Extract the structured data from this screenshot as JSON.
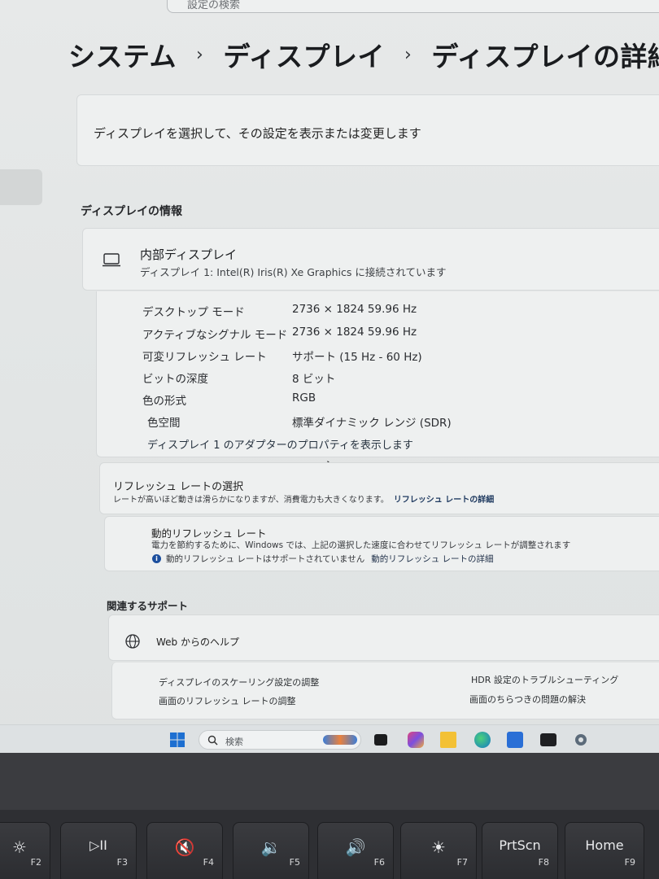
{
  "top_search": {
    "text": "設定の検索"
  },
  "breadcrumb": {
    "items": [
      "システム",
      "ディスプレイ",
      "ディスプレイの詳細設定"
    ]
  },
  "select_display": {
    "text": "ディスプレイを選択して、その設定を表示または変更します"
  },
  "display_info": {
    "section_title": "ディスプレイの情報",
    "name": "内部ディスプレイ",
    "subtitle": "ディスプレイ 1: Intel(R) Iris(R) Xe Graphics に接続されています",
    "rows": [
      {
        "label": "デスクトップ モード",
        "value": "2736 × 1824 59.96 Hz"
      },
      {
        "label": "アクティブなシグナル モード",
        "value": "2736 × 1824 59.96 Hz"
      },
      {
        "label": "可変リフレッシュ レート",
        "value": "サポート (15 Hz - 60 Hz)"
      },
      {
        "label": "ビットの深度",
        "value": "8 ビット"
      },
      {
        "label": "色の形式",
        "value": "RGB"
      },
      {
        "label": "色空間",
        "value": "標準ダイナミック レンジ (SDR)"
      }
    ],
    "adapter_link": "ディスプレイ 1 のアダプターのプロパティを表示します"
  },
  "refresh": {
    "title": "リフレッシュ レートの選択",
    "desc": "レートが高いほど動きは滑らかになりますが、消費電力も大きくなります。",
    "link": "リフレッシュ レートの詳細"
  },
  "dynamic_refresh": {
    "title": "動的リフレッシュ レート",
    "desc": "電力を節約するために、Windows では、上記の選択した速度に合わせてリフレッシュ レートが調整されます",
    "note": "動的リフレッシュ レートはサポートされていません",
    "link": "動的リフレッシュ レートの詳細"
  },
  "support": {
    "section_title": "関連するサポート",
    "web_help": "Web からのヘルプ",
    "links": [
      "ディスプレイのスケーリング設定の調整",
      "HDR 設定のトラブルシューティング",
      "画面のリフレッシュ レートの調整",
      "画面のちらつきの問題の解決"
    ]
  },
  "taskbar": {
    "search_placeholder": "検索",
    "icons": [
      "windows-start-icon",
      "search-icon",
      "widget-icon",
      "task-view-icon",
      "copilot-icon",
      "file-explorer-icon",
      "edge-icon",
      "store-icon",
      "terminal-icon",
      "settings-icon"
    ]
  },
  "keyboard": {
    "keys": [
      {
        "glyph": "☼",
        "fn": "F2"
      },
      {
        "glyph": "▷II",
        "fn": "F3"
      },
      {
        "glyph": "🔇",
        "fn": "F4"
      },
      {
        "glyph": "🔉",
        "fn": "F5"
      },
      {
        "glyph": "🔊",
        "fn": "F6"
      },
      {
        "glyph": "☀",
        "fn": "F7"
      },
      {
        "glyph": "PrtScn",
        "fn": "F8"
      },
      {
        "glyph": "Home",
        "fn": "F9"
      }
    ]
  },
  "colors": {
    "link": "#1f3a60",
    "info_icon": "#1c4f9e",
    "accent": "#0067c0"
  }
}
